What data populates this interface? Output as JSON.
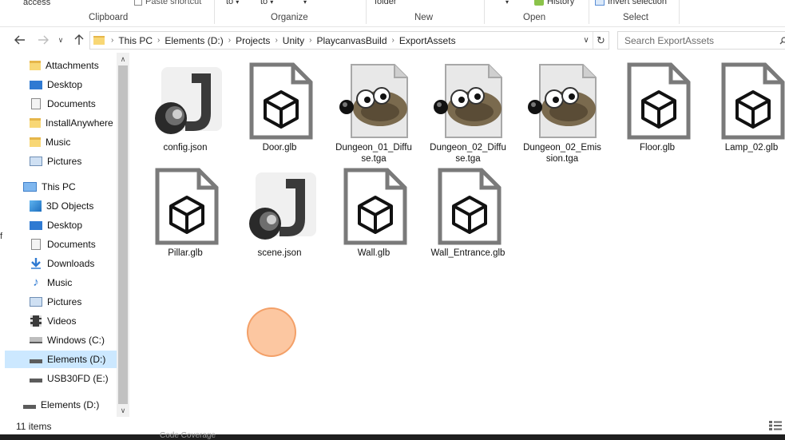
{
  "ribbon": {
    "fragments": {
      "access": "access",
      "paste_shortcut": "Paste shortcut",
      "move_to": "to",
      "copy_to": "to",
      "new_folder": "folder",
      "history": "History",
      "invert_selection": "Invert selection"
    },
    "groups": [
      "Clipboard",
      "Organize",
      "New",
      "Open",
      "Select"
    ]
  },
  "address": {
    "crumbs": [
      "This PC",
      "Elements (D:)",
      "Projects",
      "Unity",
      "PlaycanvasBuild",
      "ExportAssets"
    ]
  },
  "search": {
    "placeholder": "Search ExportAssets"
  },
  "nav": {
    "quick": [
      {
        "label": "Attachments",
        "icon": "folder-icon"
      },
      {
        "label": "Desktop",
        "icon": "desktop-icon"
      },
      {
        "label": "Documents",
        "icon": "documents-icon"
      },
      {
        "label": "InstallAnywhere",
        "icon": "folder-icon"
      },
      {
        "label": "Music",
        "icon": "folder-icon"
      },
      {
        "label": "Pictures",
        "icon": "pictures-icon"
      }
    ],
    "this_pc": "This PC",
    "pc_items": [
      {
        "label": "3D Objects",
        "icon": "3d-objects-icon"
      },
      {
        "label": "Desktop",
        "icon": "desktop-icon"
      },
      {
        "label": "Documents",
        "icon": "documents-icon"
      },
      {
        "label": "Downloads",
        "icon": "downloads-icon"
      },
      {
        "label": "Music",
        "icon": "music-icon"
      },
      {
        "label": "Pictures",
        "icon": "pictures-icon"
      },
      {
        "label": "Videos",
        "icon": "videos-icon"
      },
      {
        "label": "Windows (C:)",
        "icon": "windows-drive-icon"
      },
      {
        "label": "Elements (D:)",
        "icon": "drive-icon",
        "selected": true
      },
      {
        "label": "USB30FD (E:)",
        "icon": "drive-icon"
      }
    ],
    "bottom": {
      "label": "Elements (D:)",
      "icon": "drive-icon"
    }
  },
  "files": [
    {
      "name": "config.json",
      "icon": "json-icon"
    },
    {
      "name": "Door.glb",
      "icon": "glb-file-icon"
    },
    {
      "name": "Dungeon_01_Diffuse.tga",
      "icon": "gimp-tga-icon"
    },
    {
      "name": "Dungeon_02_Diffuse.tga",
      "icon": "gimp-tga-icon"
    },
    {
      "name": "Dungeon_02_Emission.tga",
      "icon": "gimp-tga-icon"
    },
    {
      "name": "Floor.glb",
      "icon": "glb-file-icon"
    },
    {
      "name": "Lamp_02.glb",
      "icon": "glb-file-icon"
    },
    {
      "name": "Pillar.glb",
      "icon": "glb-file-icon"
    },
    {
      "name": "scene.json",
      "icon": "json-icon"
    },
    {
      "name": "Wall.glb",
      "icon": "glb-file-icon"
    },
    {
      "name": "Wall_Entrance.glb",
      "icon": "glb-file-icon"
    }
  ],
  "status": {
    "count": "11 items"
  },
  "taskbar": {
    "text": "Code Coverage"
  },
  "left_stub": "f",
  "colors": {
    "selection": "#cce8ff",
    "cursor_indicator": "#fbb482",
    "folder": "#f8d775",
    "glb_outline": "#7a7a7a"
  }
}
